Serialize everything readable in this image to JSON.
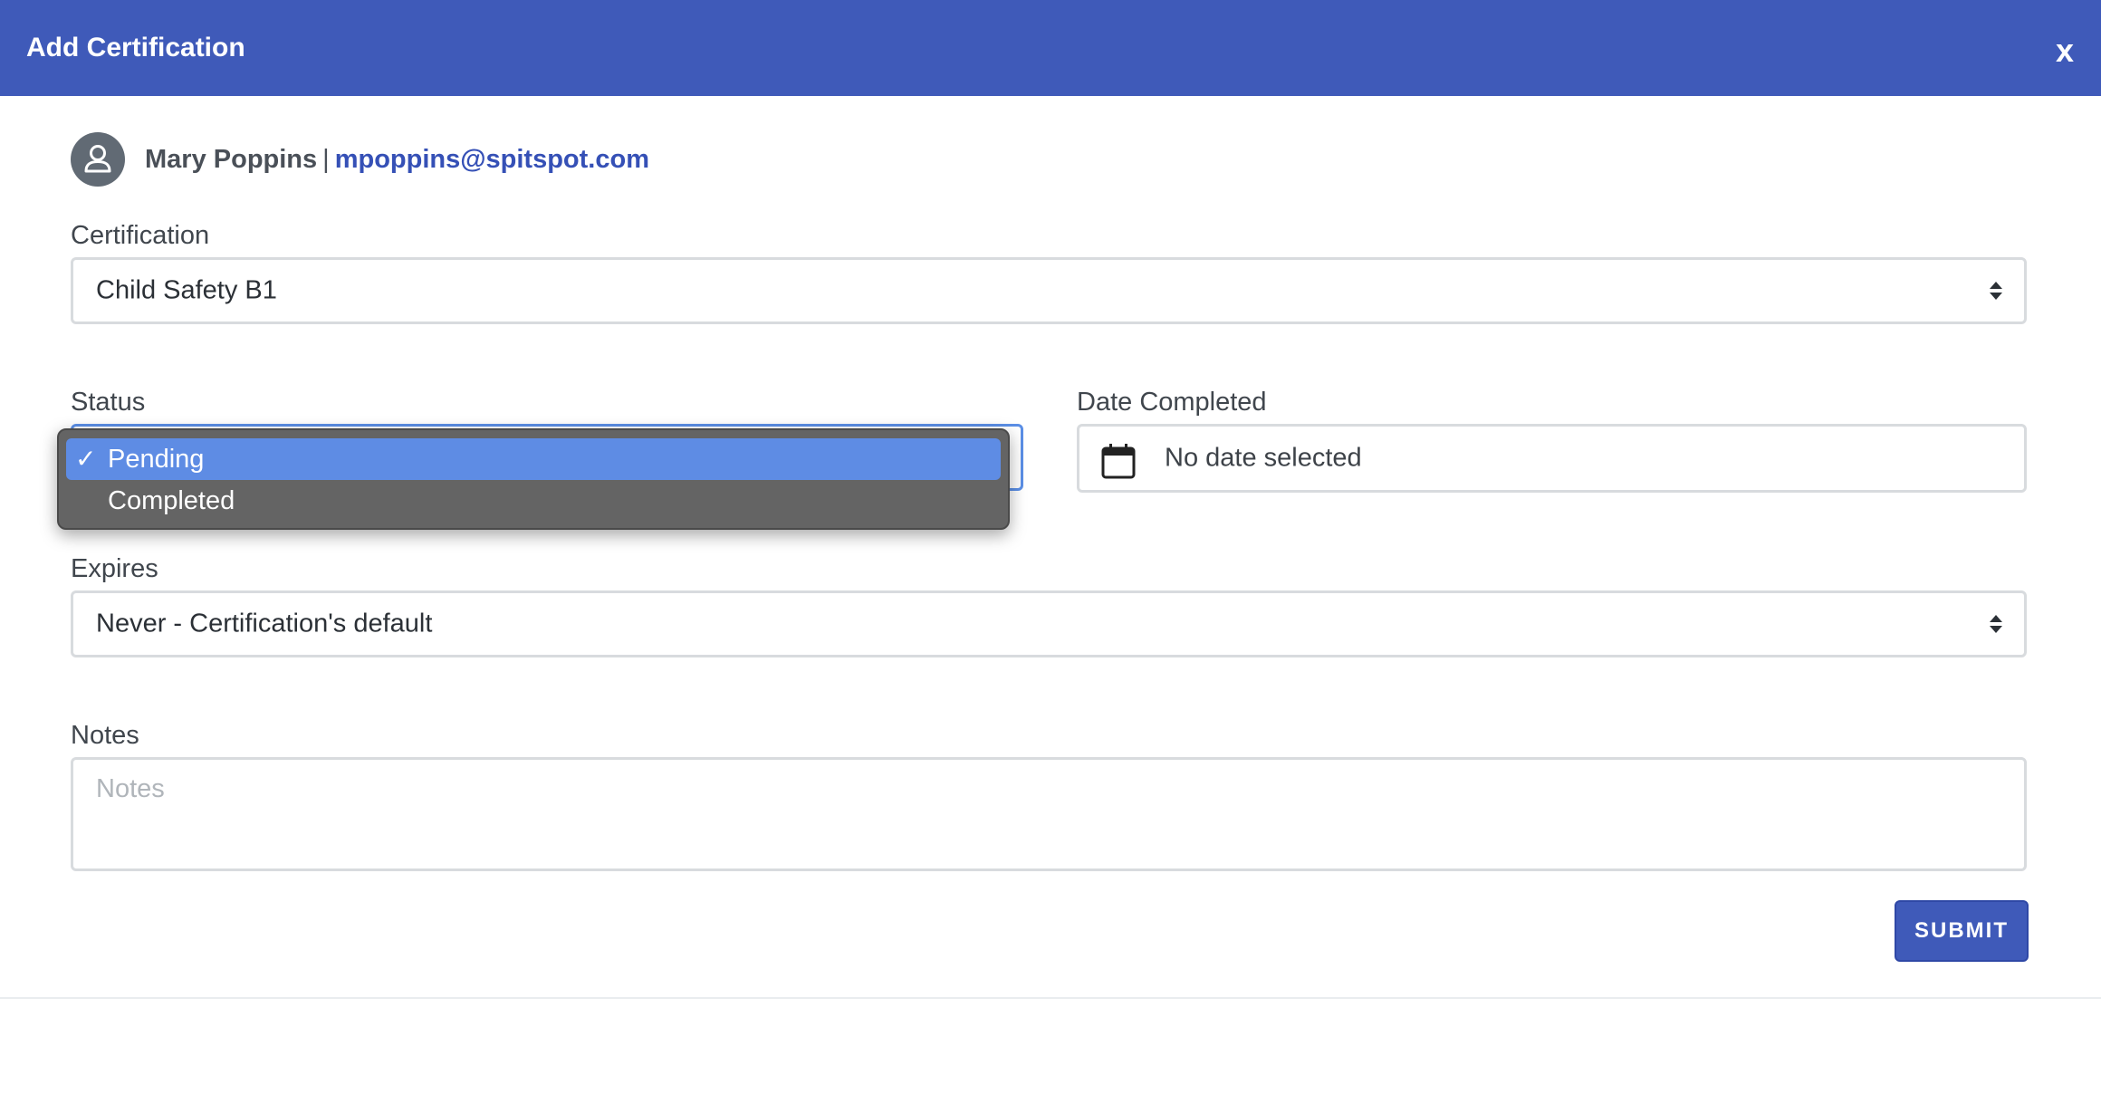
{
  "dialog": {
    "title": "Add Certification",
    "close_label": "x"
  },
  "user": {
    "name": "Mary Poppins",
    "separator": "|",
    "email": "mpoppins@spitspot.com"
  },
  "certification": {
    "label": "Certification",
    "value": "Child Safety B1"
  },
  "status": {
    "label": "Status",
    "options": [
      {
        "label": "Pending",
        "selected": true
      },
      {
        "label": "Completed",
        "selected": false
      }
    ]
  },
  "date_completed": {
    "label": "Date Completed",
    "value": "No date selected"
  },
  "expires": {
    "label": "Expires",
    "value": "Never - Certification's default"
  },
  "notes": {
    "label": "Notes",
    "placeholder": "Notes"
  },
  "submit_label": "SUBMIT",
  "colors": {
    "header": "#3f5ab9",
    "link": "#3550b6",
    "selected_option": "#5e8ce4"
  }
}
